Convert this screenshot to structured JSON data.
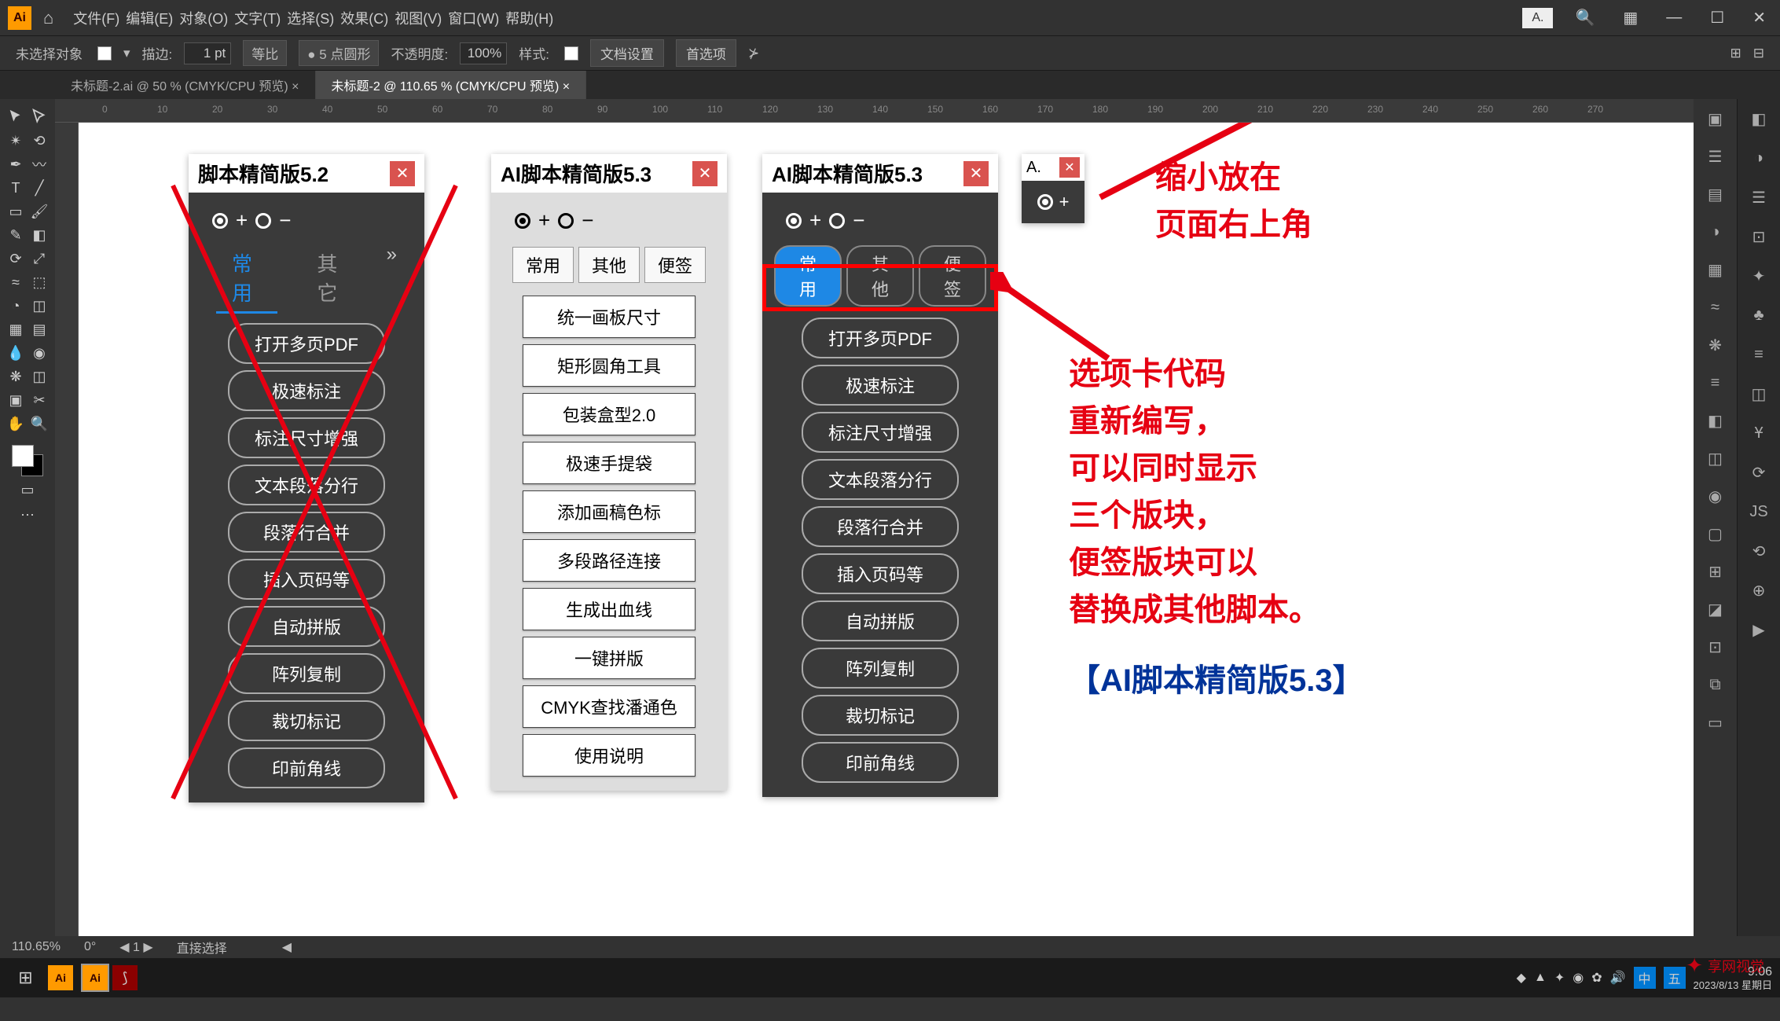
{
  "app": {
    "logo": "Ai"
  },
  "menu": [
    "文件(F)",
    "编辑(E)",
    "对象(O)",
    "文字(T)",
    "选择(S)",
    "效果(C)",
    "视图(V)",
    "窗口(W)",
    "帮助(H)"
  ],
  "mini_panel": "A.",
  "options": {
    "no_selection": "未选择对象",
    "stroke_label": "描边:",
    "stroke_value": "1 pt",
    "uniform": "等比",
    "pt_round": "5 点圆形",
    "opacity_label": "不透明度:",
    "opacity_value": "100%",
    "style_label": "样式:",
    "doc_setup": "文档设置",
    "prefs": "首选项"
  },
  "doc_tabs": [
    {
      "label": "未标题-2.ai @ 50 % (CMYK/CPU 预览)",
      "active": false
    },
    {
      "label": "未标题-2 @ 110.65 % (CMYK/CPU 预览)",
      "active": true
    }
  ],
  "ruler_marks": [
    "0",
    "10",
    "20",
    "30",
    "40",
    "50",
    "60",
    "70",
    "80",
    "90",
    "100",
    "110",
    "120",
    "130",
    "140",
    "150",
    "160",
    "170",
    "180",
    "190",
    "200",
    "210",
    "220",
    "230",
    "240",
    "250",
    "260",
    "270"
  ],
  "panel52": {
    "title": "脚本精简版5.2",
    "tabs": [
      "常用",
      "其它"
    ],
    "buttons": [
      "打开多页PDF",
      "极速标注",
      "标注尺寸增强",
      "文本段落分行",
      "段落行合并",
      "插入页码等",
      "自动拼版",
      "阵列复制",
      "裁切标记",
      "印前角线"
    ]
  },
  "panel53light": {
    "title": "AI脚本精简版5.3",
    "tabs": [
      "常用",
      "其他",
      "便签"
    ],
    "buttons": [
      "统一画板尺寸",
      "矩形圆角工具",
      "包装盒型2.0",
      "极速手提袋",
      "添加画稿色标",
      "多段路径连接",
      "生成出血线",
      "一键拼版",
      "CMYK查找潘通色",
      "使用说明"
    ]
  },
  "panel53dark": {
    "title": "AI脚本精简版5.3",
    "tabs": [
      "常用",
      "其他",
      "便签"
    ],
    "buttons": [
      "打开多页PDF",
      "极速标注",
      "标注尺寸增强",
      "文本段落分行",
      "段落行合并",
      "插入页码等",
      "自动拼版",
      "阵列复制",
      "裁切标记",
      "印前角线"
    ]
  },
  "panel_mini": {
    "title": "A."
  },
  "annotations": {
    "top": "缩小放在\n页面右上角",
    "mid": "选项卡代码\n重新编写，\n可以同时显示\n三个版块，\n便签版块可以\n替换成其他脚本。",
    "bottom": "【AI脚本精简版5.3】"
  },
  "status": {
    "zoom": "110.65%",
    "angle": "0°",
    "art": "1",
    "sel": "直接选择"
  },
  "taskbar": {
    "time": "9:06",
    "date": "2023/8/13 星期日",
    "ime": "中",
    "wubi": "五"
  },
  "watermark": "享网视觉"
}
